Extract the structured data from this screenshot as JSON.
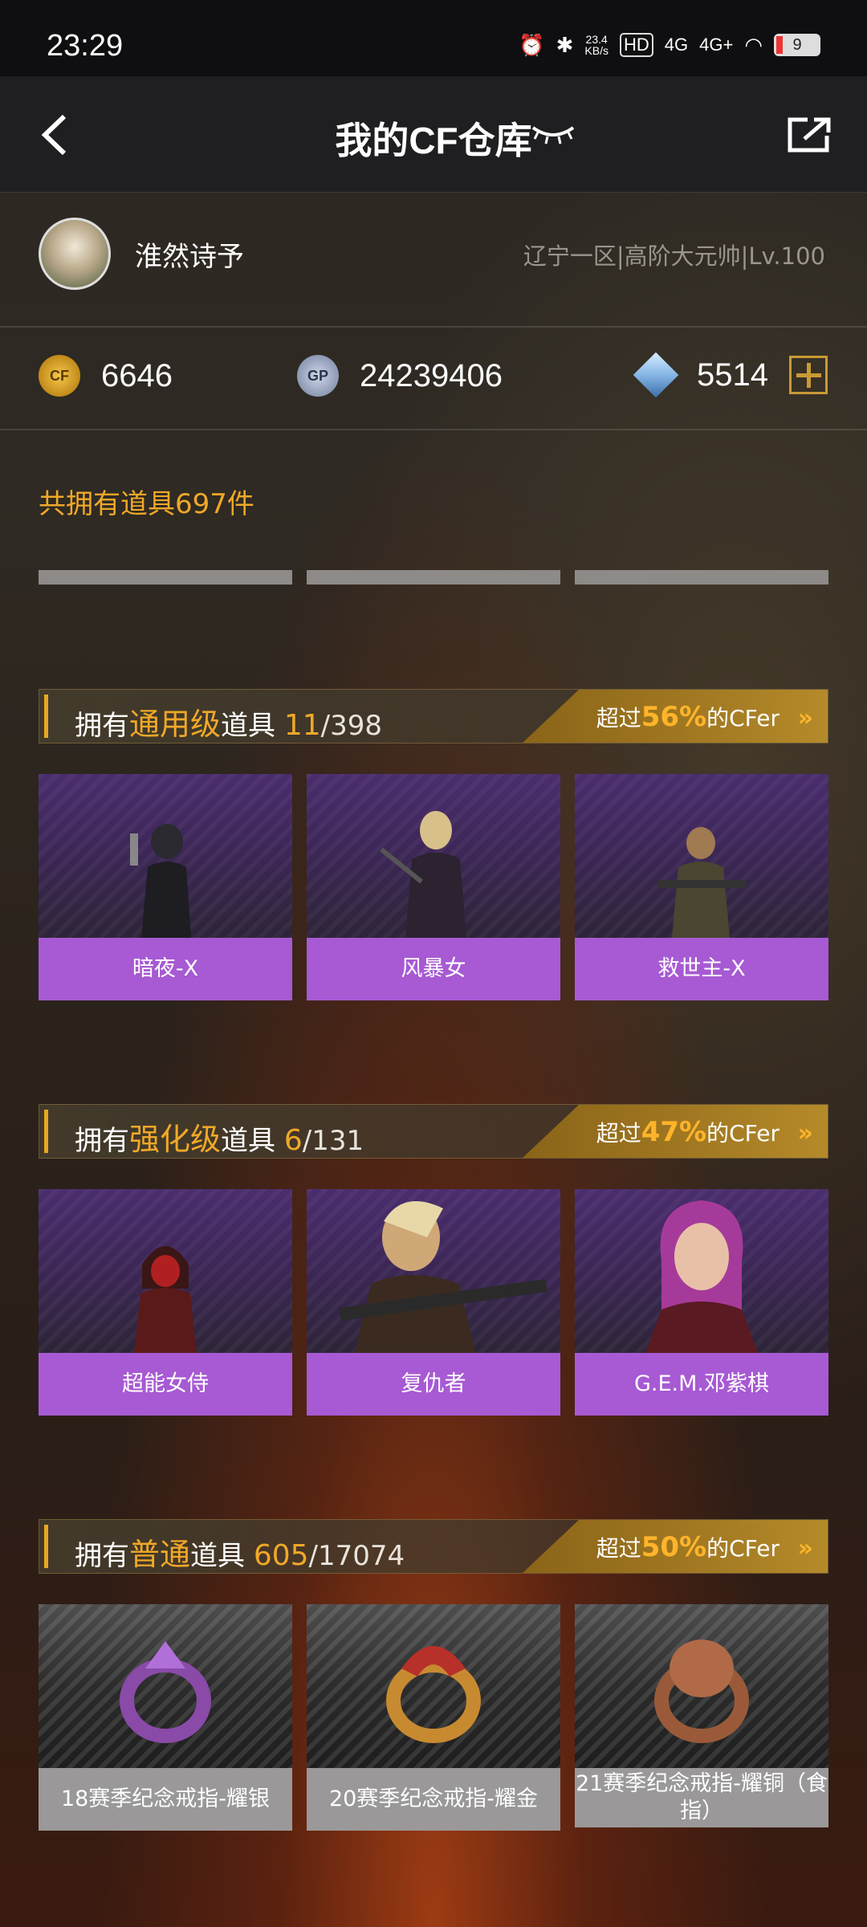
{
  "status": {
    "time": "23:29",
    "net_speed": "23.4",
    "net_unit": "KB/s",
    "hd": "HD",
    "sim1": "4G",
    "sim2": "4G+",
    "battery": "9"
  },
  "nav": {
    "title": "我的CF仓库"
  },
  "profile": {
    "username": "淮然诗予",
    "server_info": "辽宁一区|高阶大元帅|Lv.100"
  },
  "currencies": {
    "cf_points": "6646",
    "cf_icon_text": "CF",
    "gp": "24239406",
    "gp_icon_text": "GP",
    "diamonds": "5514"
  },
  "total_items": "共拥有道具697件",
  "sections": [
    {
      "prefix": "拥有",
      "grade": "通用级",
      "suffix": "道具",
      "count": "11",
      "total": "/398",
      "rank_prefix": "超过",
      "rank_pct": "56%",
      "rank_suffix": "的CFer",
      "items": [
        "暗夜-X",
        "风暴女",
        "救世主-X"
      ]
    },
    {
      "prefix": "拥有",
      "grade": "强化级",
      "suffix": "道具",
      "count": "6",
      "total": "/131",
      "rank_prefix": "超过",
      "rank_pct": "47%",
      "rank_suffix": "的CFer",
      "items": [
        "超能女侍",
        "复仇者",
        "G.E.M.邓紫棋"
      ]
    },
    {
      "prefix": "拥有",
      "grade": "普通",
      "suffix": "道具",
      "count": "605",
      "total": "/17074",
      "rank_prefix": "超过",
      "rank_pct": "50%",
      "rank_suffix": "的CFer",
      "items": [
        "18赛季纪念戒指-耀银",
        "20赛季纪念戒指-耀金",
        "21赛季纪念戒指-耀铜（食指）"
      ]
    }
  ],
  "colors": {
    "accent": "#f0a828",
    "rare_label": "#a75ad3",
    "common_label": "#9a9898"
  }
}
